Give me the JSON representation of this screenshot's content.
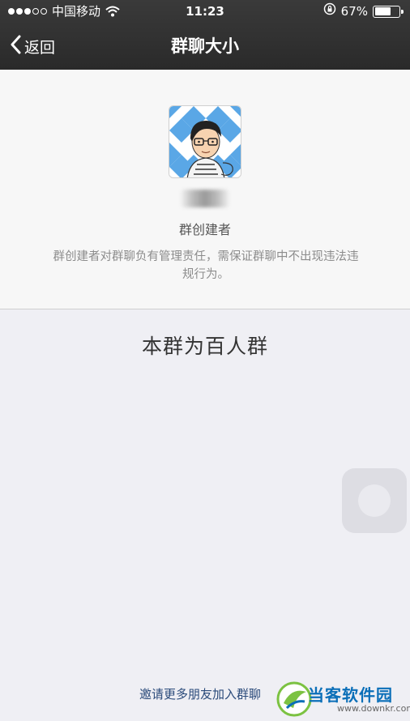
{
  "status_bar": {
    "carrier": "中国移动",
    "time": "11:23",
    "battery_percent": "67%",
    "battery_level": 0.67,
    "signal_dots_filled": 3,
    "signal_dots_total": 5
  },
  "nav": {
    "back_label": "返回",
    "title": "群聊大小"
  },
  "owner": {
    "role_label": "群创建者",
    "description": "群创建者对群聊负有管理责任，需保证群聊中不出现违法违规行为。"
  },
  "group": {
    "size_text": "本群为百人群",
    "invite_label": "邀请更多朋友加入群聊"
  },
  "watermark": {
    "name": "当客软件园",
    "url": "www.downkr.com"
  },
  "colors": {
    "nav_bg": "#2f2f2f",
    "link": "#2a4a7a",
    "avatar_tile": "#5aa7e6"
  }
}
